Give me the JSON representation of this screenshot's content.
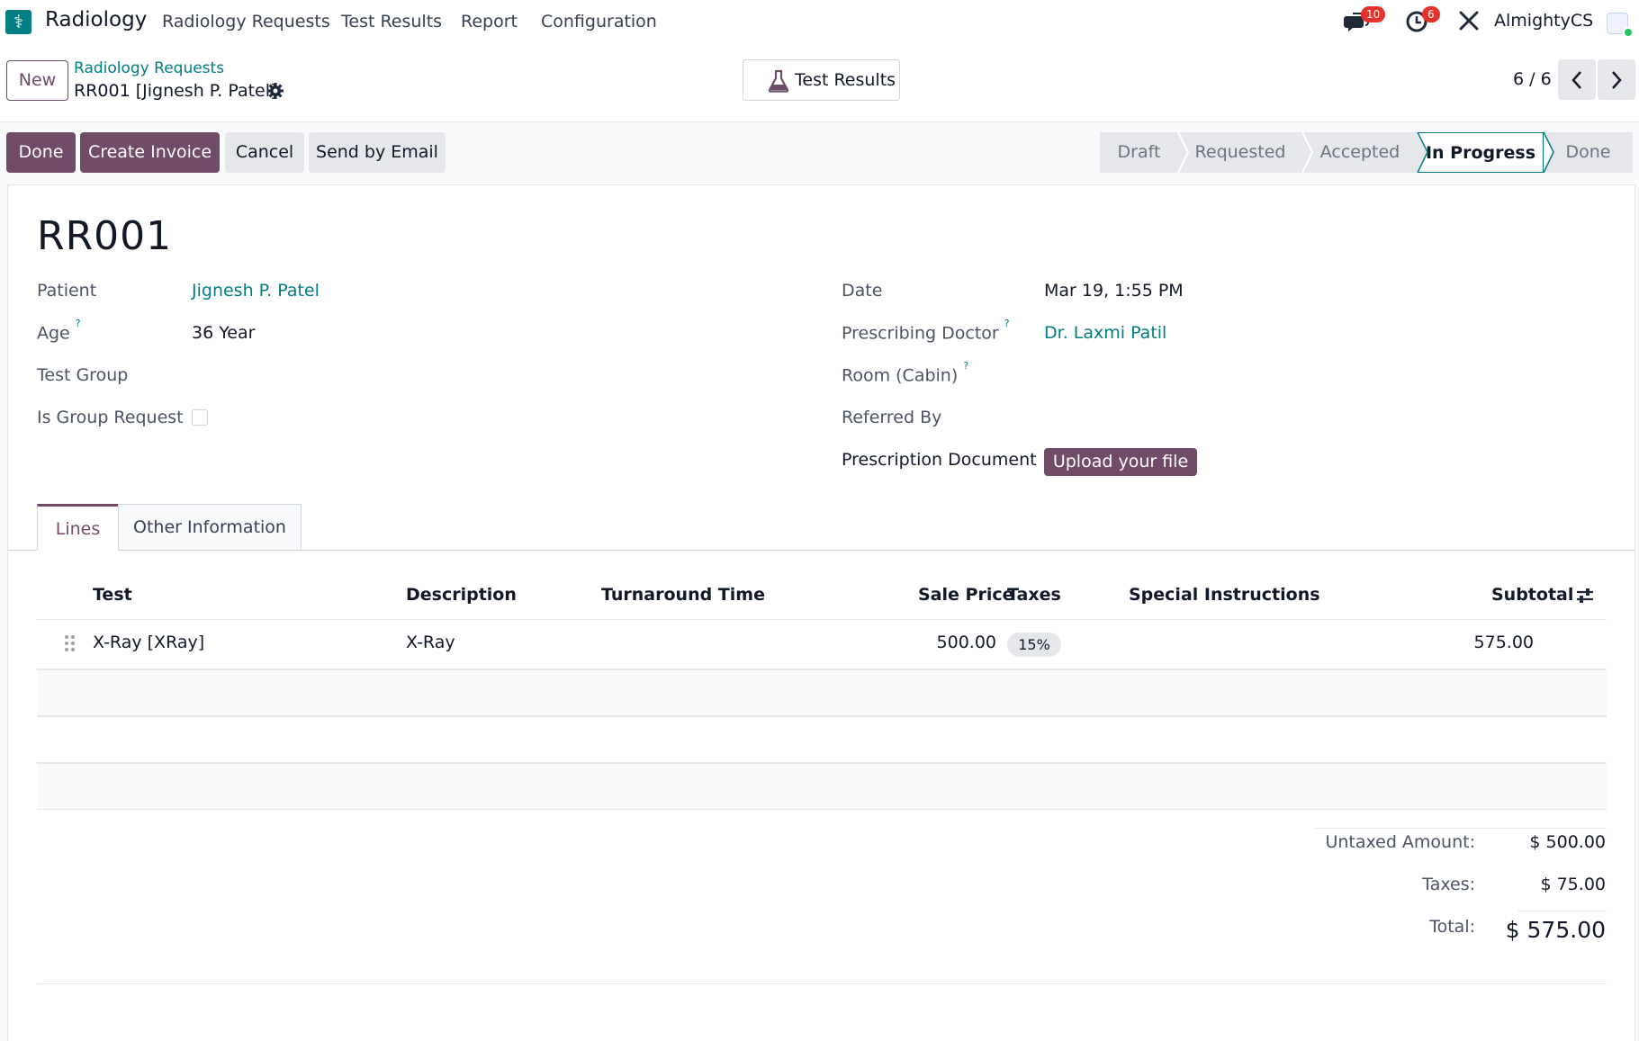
{
  "app": {
    "name": "Radiology",
    "menu": [
      "Radiology Requests",
      "Test Results",
      "Report",
      "Configuration"
    ],
    "messages_count": "10",
    "activities_count": "6",
    "company": "AlmightyCS"
  },
  "control": {
    "new_label": "New",
    "breadcrumb": "Radiology Requests",
    "record_title": "RR001 [Jignesh P. Patel]",
    "smart_button": "Test Results",
    "pager": "6 / 6"
  },
  "actions": {
    "done": "Done",
    "create_invoice": "Create Invoice",
    "cancel": "Cancel",
    "send_email": "Send by Email"
  },
  "statusbar": {
    "stages": [
      "Draft",
      "Requested",
      "Accepted",
      "In Progress",
      "Done"
    ],
    "active": "In Progress"
  },
  "form": {
    "name": "RR001",
    "patient_label": "Patient",
    "patient": "Jignesh P. Patel",
    "age_label": "Age",
    "age": "36 Year",
    "test_group_label": "Test Group",
    "is_group_label": "Is Group Request",
    "date_label": "Date",
    "date": "Mar 19, 1:55 PM",
    "doctor_label": "Prescribing Doctor",
    "doctor": "Dr. Laxmi Patil",
    "room_label": "Room (Cabin)",
    "referred_label": "Referred By",
    "prescription_label": "Prescription Document",
    "upload_label": "Upload your file",
    "help_mark": "?"
  },
  "tabs": [
    "Lines",
    "Other Information"
  ],
  "lines": {
    "columns": [
      "Test",
      "Description",
      "Turnaround Time",
      "Sale Price",
      "Taxes",
      "Special Instructions",
      "Subtotal"
    ],
    "rows": [
      {
        "test": "X-Ray [XRay]",
        "description": "X-Ray",
        "turnaround": "",
        "sale_price": "500.00",
        "taxes": "15%",
        "special": "",
        "subtotal": "575.00"
      }
    ]
  },
  "totals": {
    "untaxed_label": "Untaxed Amount:",
    "untaxed": "$ 500.00",
    "taxes_label": "Taxes:",
    "taxes": "$ 75.00",
    "total_label": "Total:",
    "total": "$ 575.00"
  },
  "colors": {
    "primary": "#714b67",
    "link": "#017e84",
    "badge": "#e5322d"
  }
}
